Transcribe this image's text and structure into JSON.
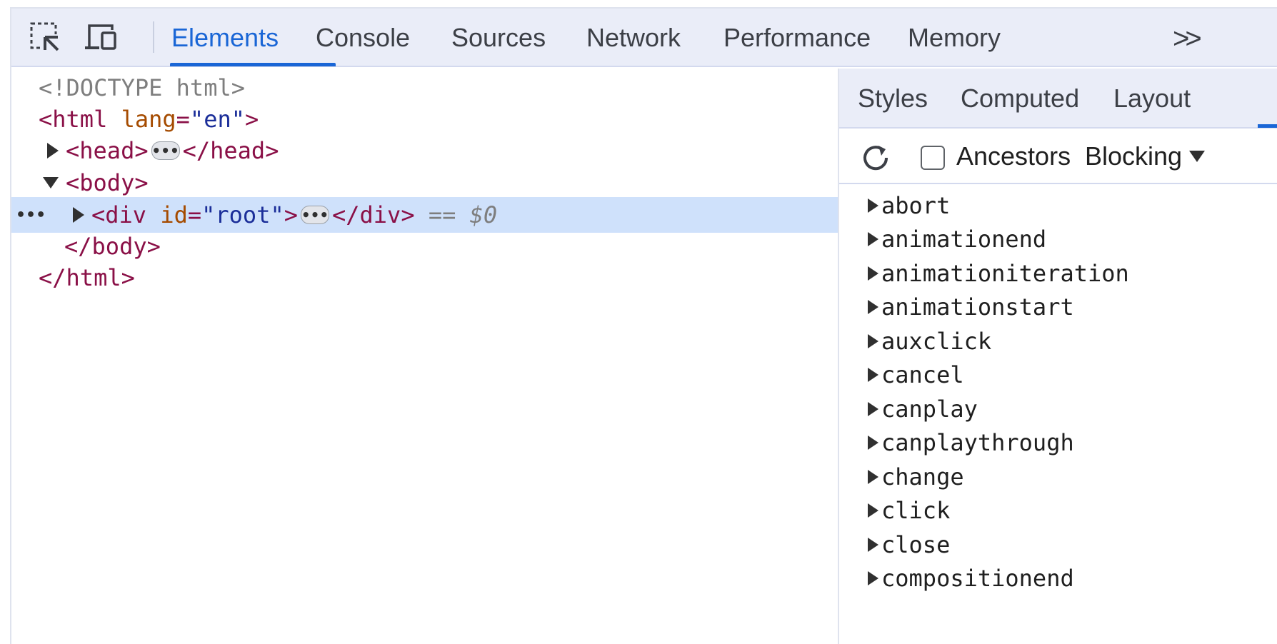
{
  "toolbar": {
    "icons": [
      "inspect-element-icon",
      "device-toolbar-icon"
    ],
    "tabs": [
      "Elements",
      "Console",
      "Sources",
      "Network",
      "Performance",
      "Memory"
    ],
    "active_tab": "Elements",
    "more_label": ">>"
  },
  "dom": {
    "doctype": "<!DOCTYPE html>",
    "html_open": "<html",
    "html_attr": "lang",
    "html_attr_val": "\"en\"",
    "html_close_bracket": ">",
    "head_open": "<head>",
    "head_close": "</head>",
    "ellipsis": "•••",
    "body_open": "<body>",
    "div_open": "<div",
    "div_attr": "id",
    "div_attr_val": "\"root\"",
    "div_close_bracket": ">",
    "div_close": "</div>",
    "selected_marker": "== ",
    "selected_ref": "$0",
    "gutter_dots": "•••",
    "body_close": "</body>",
    "html_close": "</html>"
  },
  "sidebar": {
    "tabs": [
      "Styles",
      "Computed",
      "Layout"
    ],
    "refresh_icon": "refresh-icon",
    "ancestors_label": "Ancestors",
    "ancestors_checked": false,
    "blocking_label": "Blocking",
    "events": [
      "abort",
      "animationend",
      "animationiteration",
      "animationstart",
      "auxclick",
      "cancel",
      "canplay",
      "canplaythrough",
      "change",
      "click",
      "close",
      "compositionend"
    ]
  },
  "colors": {
    "accent": "#1a66d6",
    "toolbar_bg": "#eaedf8",
    "selected_row": "#cfe1fb",
    "tag": "#8a1047",
    "attr": "#a54b00",
    "value": "#1b2e99"
  }
}
